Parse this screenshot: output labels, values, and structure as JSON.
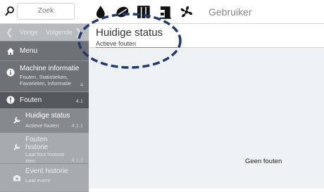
{
  "topbar": {
    "search_placeholder": "Zoek",
    "icons": [
      "drop-icon",
      "coffee-bean-icon",
      "milk-system-icon",
      "coffee-machine-icon",
      "fan-service-icon"
    ],
    "user_label": "Gebruiker"
  },
  "sidebar": {
    "nav": {
      "prev_label": "Vorige",
      "next_label": "Volgende"
    },
    "menu": {
      "label": "Menu"
    },
    "machine_info": {
      "label": "Machine informatie",
      "sub": "Fouten, Statistieken, Favorieten, Informatie",
      "num": "4"
    },
    "faults": {
      "label": "Fouten",
      "num": "4.1"
    },
    "current_status": {
      "label": "Huidige status",
      "sub": "Actieve fouten",
      "num": "4.1.1"
    },
    "fault_history": {
      "label": "Fouten historie",
      "sub": "Laat fout historie zien",
      "num": "4.1.2"
    },
    "event_history": {
      "label": "Event historie",
      "sub": "Laat event"
    }
  },
  "main": {
    "title": "Huidige status",
    "subtitle": "Actieve fouten",
    "empty_message": "Geen fouten"
  },
  "colors": {
    "sidebar_dark": "#6e7277",
    "sidebar_active": "#54585d",
    "sidebar_light": "#a7aaae",
    "main_bg": "#edf1f4",
    "highlight": "#1f3a6e"
  }
}
